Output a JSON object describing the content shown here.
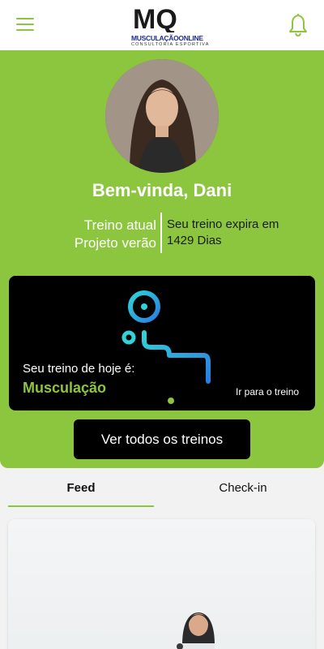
{
  "header": {
    "menu_icon": "hamburger-menu-icon",
    "logo_mark": "MQ",
    "logo_brand": "MUSCULAÇÃOONLINE",
    "logo_subtitle": "CONSULTORIA ESPORTIVA",
    "notification_icon": "bell-icon"
  },
  "profile": {
    "greeting": "Bem-vinda, Dani",
    "plan_label": "Treino atual",
    "plan_name": "Projeto verão",
    "expiry_label": "Seu treino expira em",
    "expiry_value": "1429 Dias"
  },
  "today_card": {
    "label": "Seu treino de hoje é:",
    "workout": "Musculação",
    "link": "Ir para o treino",
    "icon": "workout-illustration-icon"
  },
  "buttons": {
    "all_workouts": "Ver todos os treinos"
  },
  "tabs": [
    {
      "label": "Feed",
      "active": true
    },
    {
      "label": "Check-in",
      "active": false
    }
  ],
  "colors": {
    "accent": "#8cc63f",
    "illustration_cyan": "#2fd3d8",
    "illustration_blue": "#2a7de1",
    "logo_blue": "#1f2d8f"
  }
}
